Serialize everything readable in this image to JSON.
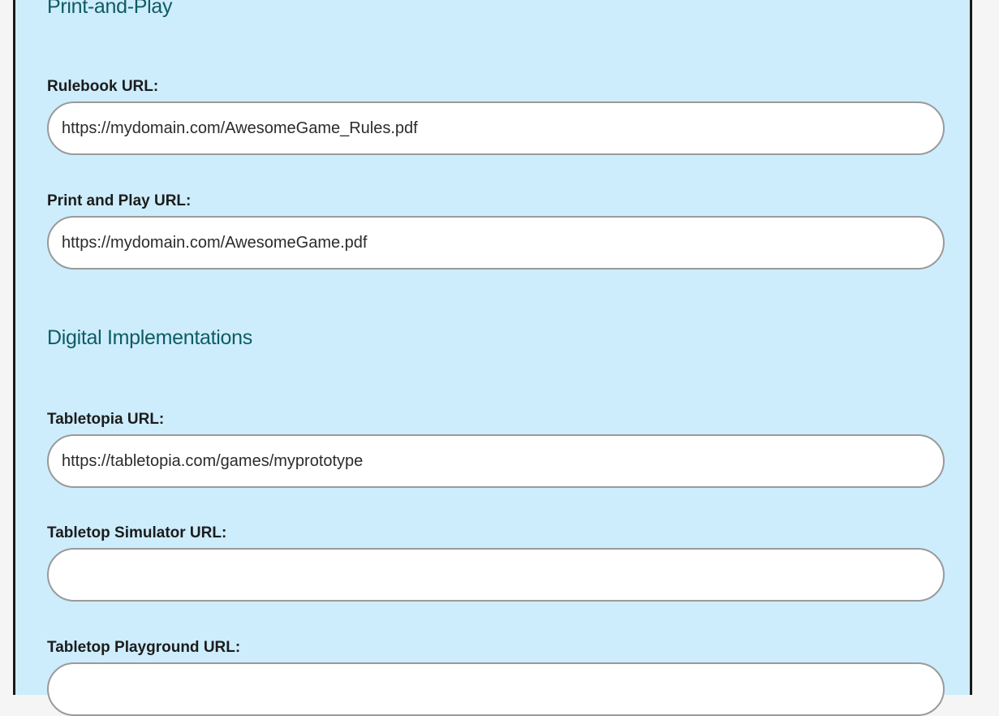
{
  "sections": {
    "print_and_play": {
      "title": "Print-and-Play",
      "rulebook": {
        "label": "Rulebook URL:",
        "value": "https://mydomain.com/AwesomeGame_Rules.pdf"
      },
      "print_play": {
        "label": "Print and Play URL:",
        "value": "https://mydomain.com/AwesomeGame.pdf"
      }
    },
    "digital": {
      "title": "Digital Implementations",
      "tabletopia": {
        "label": "Tabletopia URL:",
        "value": "https://tabletopia.com/games/myprototype"
      },
      "simulator": {
        "label": "Tabletop Simulator URL:",
        "value": ""
      },
      "playground": {
        "label": "Tabletop Playground URL:",
        "value": ""
      }
    }
  },
  "colors": {
    "panel_background": "#cdedfd",
    "section_title": "#0f5b63",
    "input_border": "#9a9a9a"
  }
}
